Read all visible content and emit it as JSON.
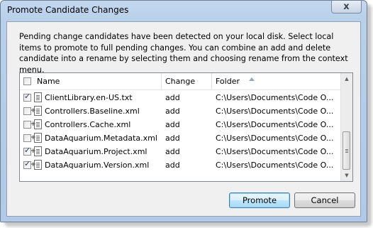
{
  "window": {
    "title": "Promote Candidate Changes",
    "close_glyph": "x"
  },
  "description": "Pending change candidates have been detected on your local disk. Select local items to promote to full pending changes. You can combine an add and delete candidate into a rename by selecting them and choosing rename from the context menu.",
  "list": {
    "columns": {
      "name": "Name",
      "change": "Change",
      "folder": "Folder"
    },
    "sort_icon": "sort-ascending-icon",
    "rows": [
      {
        "name": "ClientLibrary.en-US.txt",
        "change": "add",
        "folder": "C:\\Users\\Documents\\Code O...",
        "checked": true
      },
      {
        "name": "Controllers.Baseline.xml",
        "change": "add",
        "folder": "C:\\Users\\Documents\\Code O...",
        "checked": false
      },
      {
        "name": "Controllers.Cache.xml",
        "change": "add",
        "folder": "C:\\Users\\Documents\\Code O...",
        "checked": false
      },
      {
        "name": "DataAquarium.Metadata.xml",
        "change": "add",
        "folder": "C:\\Users\\Documents\\Code O...",
        "checked": false
      },
      {
        "name": "DataAquarium.Project.xml",
        "change": "add",
        "folder": "C:\\Users\\Documents\\Code O...",
        "checked": true
      },
      {
        "name": "DataAquarium.Version.xml",
        "change": "add",
        "folder": "C:\\Users\\Documents\\Code O...",
        "checked": true
      }
    ]
  },
  "buttons": {
    "promote": "Promote",
    "cancel": "Cancel"
  },
  "colors": {
    "titlebar": "#b8cfe9",
    "default_button_border": "#3c7fb1"
  }
}
